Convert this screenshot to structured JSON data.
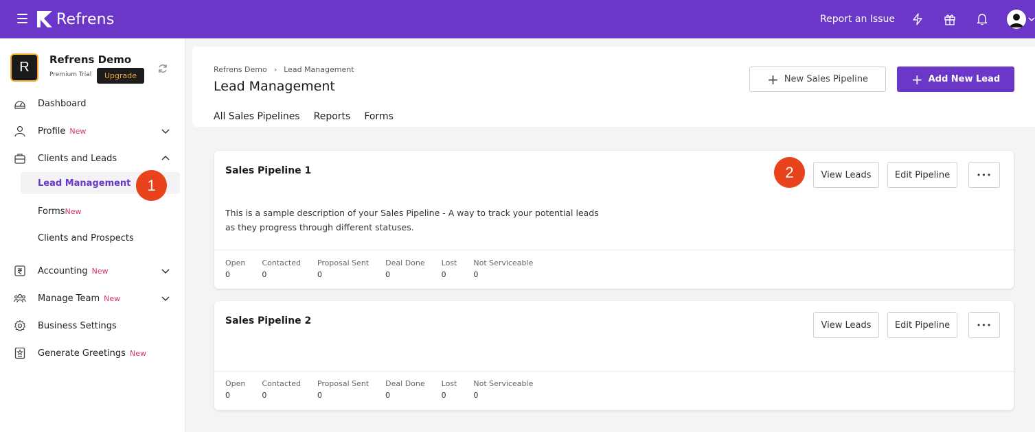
{
  "app": {
    "name": "Refrens"
  },
  "topbar": {
    "report_issue": "Report an Issue",
    "icons": [
      "bolt-icon",
      "gift-icon",
      "bell-icon",
      "user-avatar-icon"
    ]
  },
  "org": {
    "initial": "R",
    "name": "Refrens Demo",
    "plan": "Premium Trial",
    "upgrade": "Upgrade"
  },
  "sidebar": {
    "new_badge": "New",
    "items": [
      {
        "label": "Dashboard",
        "icon": "dashboard-icon"
      },
      {
        "label": "Profile",
        "icon": "user-icon",
        "badge": "New"
      },
      {
        "label": "Clients and Leads",
        "icon": "briefcase-icon"
      },
      {
        "label": "Accounting",
        "icon": "rupee-icon",
        "badge": "New"
      },
      {
        "label": "Manage Team",
        "icon": "team-icon",
        "badge": "New"
      },
      {
        "label": "Business Settings",
        "icon": "gear-icon"
      },
      {
        "label": "Generate Greetings",
        "icon": "greeting-icon",
        "badge": "New"
      }
    ],
    "subitems": [
      {
        "label": "Lead Management"
      },
      {
        "label": "Forms",
        "badge": "New"
      },
      {
        "label": "Clients and Prospects"
      }
    ]
  },
  "steps": {
    "one": "1",
    "two": "2"
  },
  "header": {
    "breadcrumb": [
      "Refrens Demo",
      "Lead Management"
    ],
    "title": "Lead Management",
    "tabs": [
      "All Sales Pipelines",
      "Reports",
      "Forms"
    ],
    "new_pipeline": "New Sales Pipeline",
    "add_lead": "Add New Lead"
  },
  "pipelines": [
    {
      "name": "Sales Pipeline 1",
      "description_line1": "This is a sample description of your Sales Pipeline - A way to track your potential leads",
      "description_line2": "as they progress through different statuses.",
      "view_leads": "View Leads",
      "edit_pipeline": "Edit Pipeline",
      "more": "•••",
      "stats": [
        {
          "label": "Open",
          "value": "0"
        },
        {
          "label": "Contacted",
          "value": "0"
        },
        {
          "label": "Proposal Sent",
          "value": "0"
        },
        {
          "label": "Deal Done",
          "value": "0"
        },
        {
          "label": "Lost",
          "value": "0"
        },
        {
          "label": "Not Serviceable",
          "value": "0"
        }
      ]
    },
    {
      "name": "Sales Pipeline 2",
      "view_leads": "View Leads",
      "edit_pipeline": "Edit Pipeline",
      "more": "•••",
      "stats": [
        {
          "label": "Open",
          "value": "0"
        },
        {
          "label": "Contacted",
          "value": "0"
        },
        {
          "label": "Proposal Sent",
          "value": "0"
        },
        {
          "label": "Deal Done",
          "value": "0"
        },
        {
          "label": "Lost",
          "value": "0"
        },
        {
          "label": "Not Serviceable",
          "value": "0"
        }
      ]
    }
  ],
  "colors": {
    "brand": "#6a37c9",
    "step_badge": "#e8431c",
    "new_badge": "#d6336c",
    "upgrade_text": "#f7a541"
  }
}
